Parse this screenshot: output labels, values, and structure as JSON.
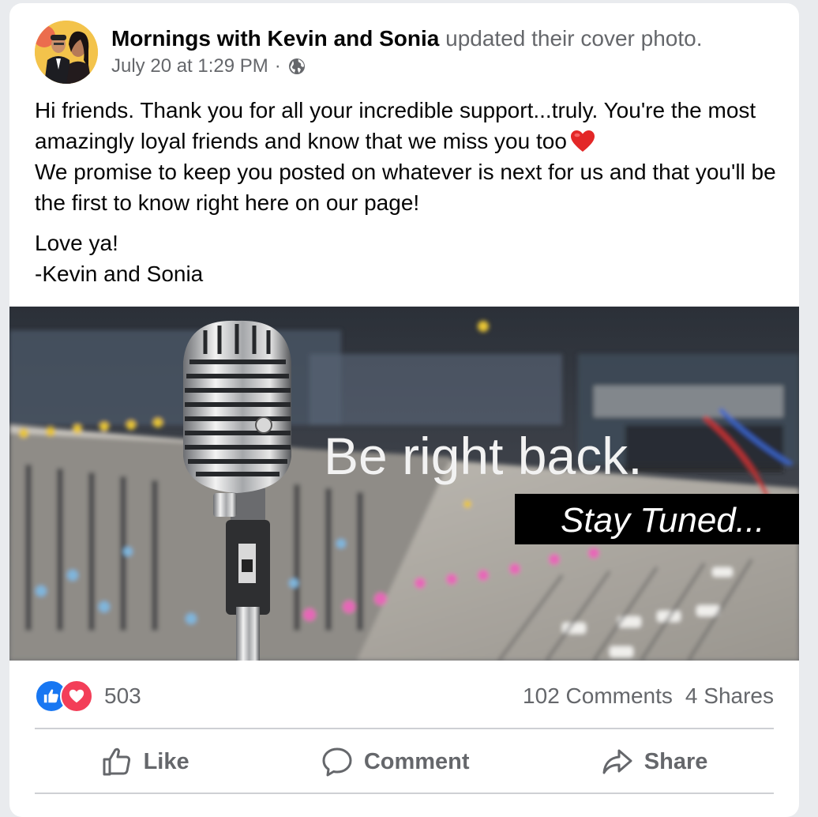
{
  "post": {
    "page_name": "Mornings with Kevin and Sonia",
    "action": "updated their cover photo.",
    "timestamp": "July 20 at 1:29 PM",
    "separator": "·",
    "paragraph1": "Hi friends. Thank you for all your incredible support...truly. You're the most amazingly loyal friends and know that we miss you too",
    "paragraph1b": "We promise to keep you posted on whatever is next for us and that you'll be the first to know right here on our page!",
    "signoff1": "Love ya!",
    "signoff2": "-Kevin and Sonia"
  },
  "photo": {
    "headline": "Be right back.",
    "subline": "Stay Tuned..."
  },
  "stats": {
    "reaction_count": "503",
    "comments": "102 Comments",
    "shares": "4 Shares"
  },
  "actions": {
    "like_label": "Like",
    "comment_label": "Comment",
    "share_label": "Share"
  },
  "icons": {
    "globe": "globe-icon",
    "like": "thumbs-up-icon",
    "comment": "speech-bubble-icon",
    "share": "share-arrow-icon",
    "heart": "heart-icon"
  },
  "colors": {
    "like_blue": "#1877f2",
    "love_red": "#f33e58",
    "secondary_text": "#65676b"
  }
}
